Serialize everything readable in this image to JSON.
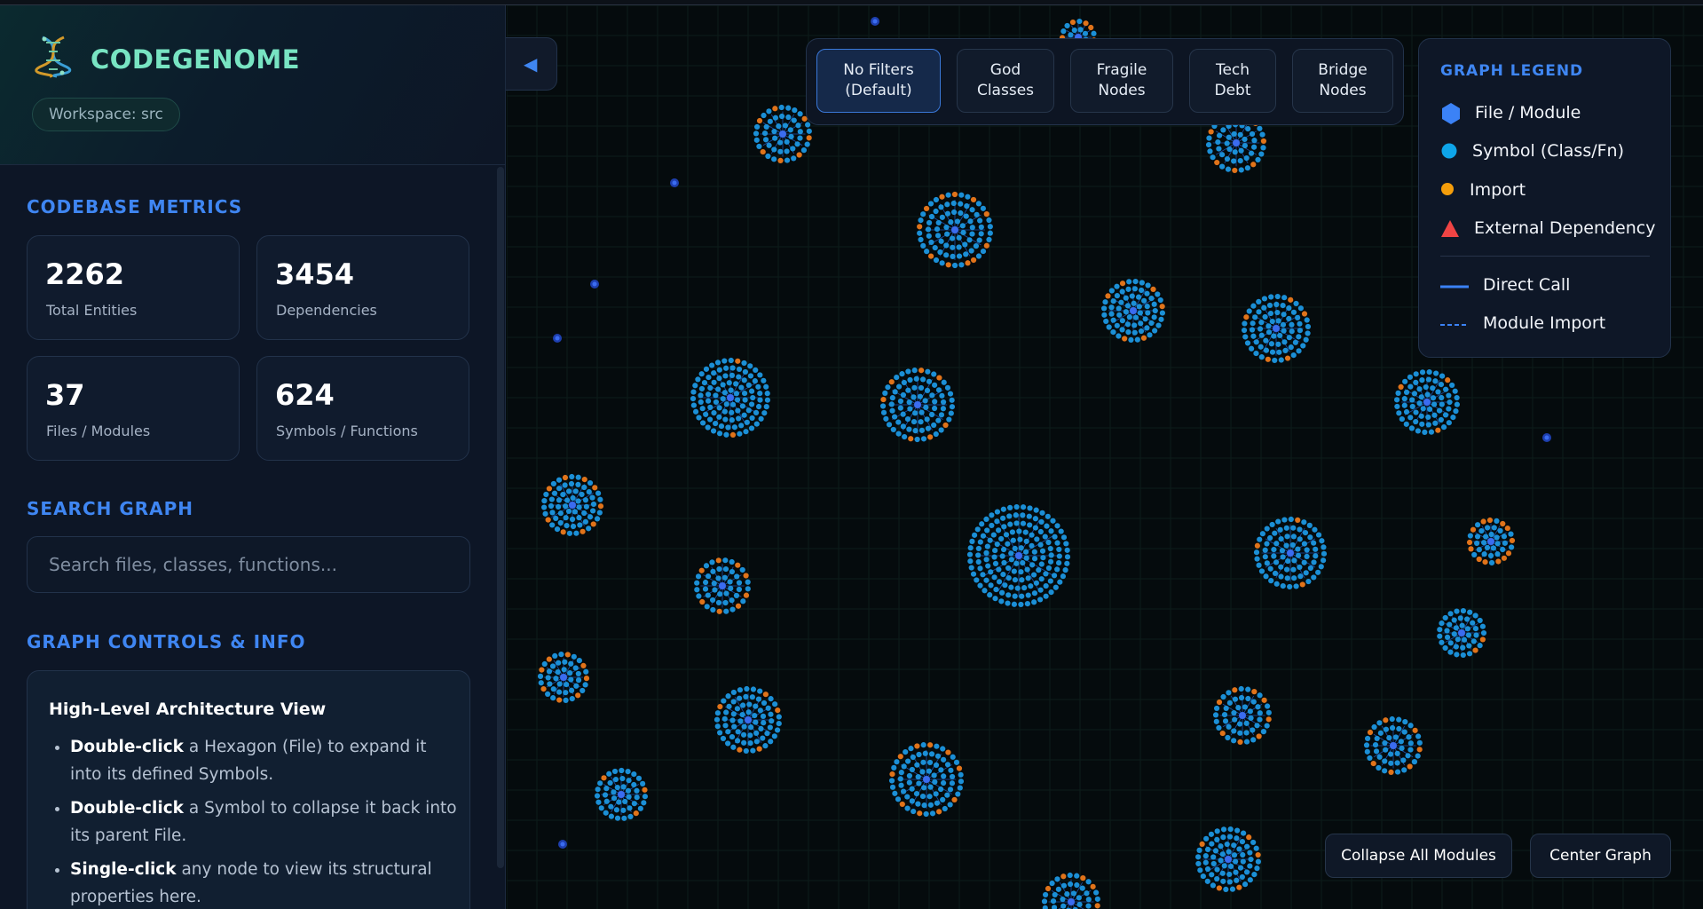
{
  "app": {
    "title": "CODEGENOME",
    "workspace_badge": "Workspace: src"
  },
  "metrics": {
    "section_title": "CODEBASE METRICS",
    "cards": [
      {
        "value": "2262",
        "label": "Total Entities"
      },
      {
        "value": "3454",
        "label": "Dependencies"
      },
      {
        "value": "37",
        "label": "Files / Modules"
      },
      {
        "value": "624",
        "label": "Symbols / Functions"
      }
    ]
  },
  "search": {
    "section_title": "SEARCH GRAPH",
    "placeholder": "Search files, classes, functions..."
  },
  "controls": {
    "section_title": "GRAPH CONTROLS & INFO",
    "card_title": "High-Level Architecture View",
    "items": [
      {
        "bold": "Double-click",
        "text": " a Hexagon (File) to expand it into its defined Symbols."
      },
      {
        "bold": "Double-click",
        "text": " a Symbol to collapse it back into its parent File."
      },
      {
        "bold": "Single-click",
        "text": " any node to view its structural properties here."
      }
    ]
  },
  "sidebar_toggle": {
    "icon": "◀"
  },
  "filters": [
    {
      "label": "No Filters\n(Default)",
      "active": true
    },
    {
      "label": "God\nClasses",
      "active": false
    },
    {
      "label": "Fragile\nNodes",
      "active": false
    },
    {
      "label": "Tech\nDebt",
      "active": false
    },
    {
      "label": "Bridge\nNodes",
      "active": false
    }
  ],
  "legend": {
    "title": "GRAPH LEGEND",
    "items": [
      {
        "label": "File / Module",
        "icon": "hexagon-icon",
        "color": "#3b82f6"
      },
      {
        "label": "Symbol (Class/Fn)",
        "icon": "circle-icon",
        "color": "#0ea5e9"
      },
      {
        "label": "Import",
        "icon": "circle-icon",
        "color": "#f59e0b"
      },
      {
        "label": "External Dependency",
        "icon": "triangle-icon",
        "color": "#ef4444"
      },
      {
        "label": "Direct Call",
        "icon": "solid-line-icon",
        "color": "#3b82f6"
      },
      {
        "label": "Module Import",
        "icon": "dashed-line-icon",
        "color": "#3b82f6"
      }
    ]
  },
  "actions": {
    "collapse_all": "Collapse All Modules",
    "center_graph": "Center Graph"
  },
  "colors": {
    "accent": "#3f86f2",
    "brand": "#78e4c2",
    "symbol_node": "#1b8fd6",
    "import_node": "#e0731a",
    "file_node": "#3b6cf0"
  }
}
